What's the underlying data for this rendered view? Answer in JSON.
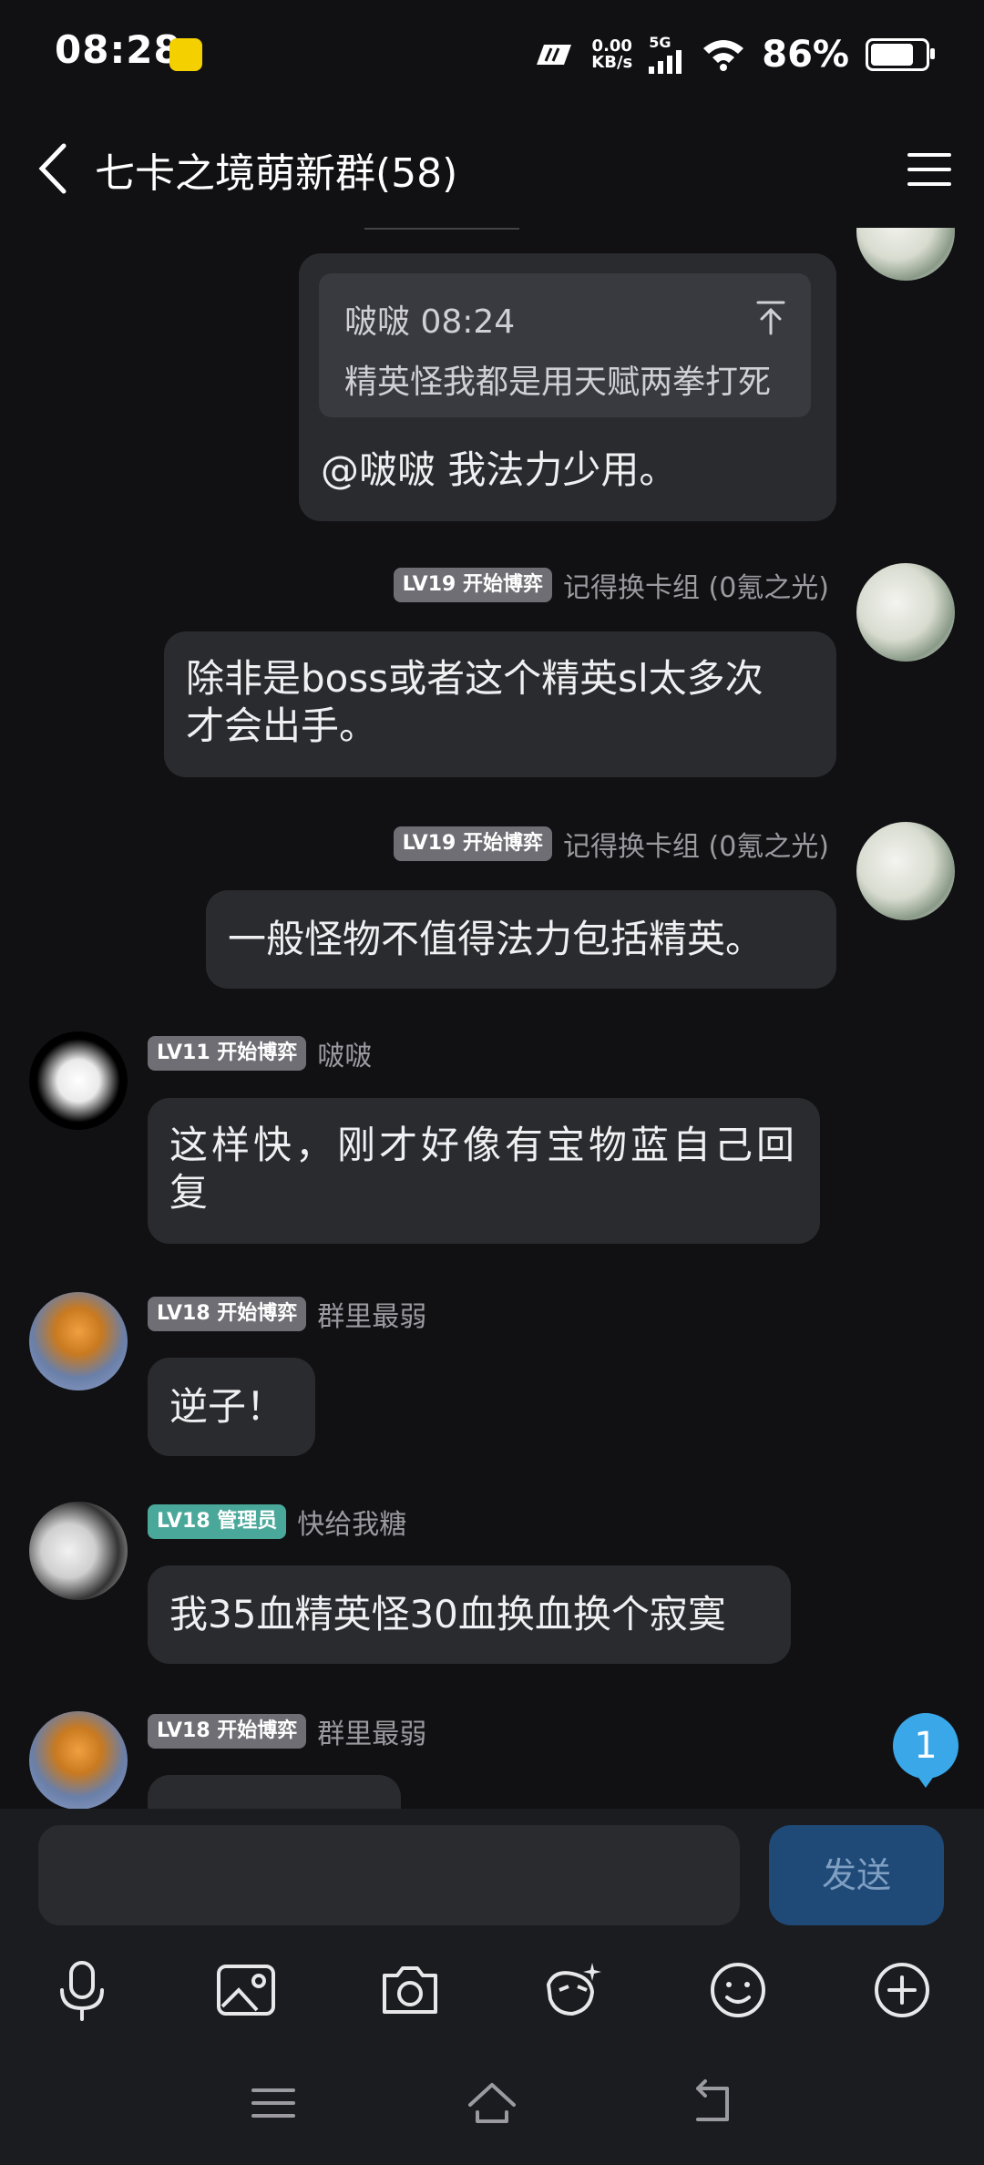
{
  "status_bar": {
    "time": "08:28",
    "speed_value": "0.00",
    "speed_unit": "KB/s",
    "network": "5G",
    "battery": "86%"
  },
  "header": {
    "title": "七卡之境萌新群(58)",
    "back_icon": "chevron-left-icon",
    "menu_icon": "hamburger-icon"
  },
  "messages": [
    {
      "id": 1,
      "side": "right",
      "quote": {
        "author_time": "啵啵 08:24",
        "text": "精英怪我都是用天赋两拳打死"
      },
      "text": "@啵啵 我法力少用。"
    },
    {
      "id": 2,
      "side": "right",
      "badge": "LV19 开始博弈",
      "name": "记得换卡组 (0氪之光)",
      "text_lines": [
        "除非是boss或者这个精英sl太多次",
        "才会出手。"
      ]
    },
    {
      "id": 3,
      "side": "right",
      "badge": "LV19 开始博弈",
      "name": "记得换卡组 (0氪之光)",
      "text": "一般怪物不值得法力包括精英。"
    },
    {
      "id": 4,
      "side": "left",
      "badge": "LV11 开始博弈",
      "name": "啵啵",
      "text_lines": [
        "这样快，刚才好像有宝物蓝自己回",
        "复"
      ]
    },
    {
      "id": 5,
      "side": "left",
      "badge": "LV18 开始博弈",
      "name": "群里最弱",
      "text": "逆子！"
    },
    {
      "id": 6,
      "side": "left",
      "badge": "LV18 管理员",
      "name": "快给我糖",
      "text": "我35血精英怪30血换血换个寂寞"
    },
    {
      "id": 7,
      "side": "left",
      "badge": "LV18 开始博弈",
      "name": "群里最弱"
    }
  ],
  "unread_count": "1",
  "input": {
    "value": "",
    "placeholder": "",
    "send_label": "发送"
  },
  "toolbar": [
    "microphone-icon",
    "image-icon",
    "camera-icon",
    "sticker-icon",
    "emoji-icon",
    "plus-icon"
  ],
  "navbar": [
    "menu-icon",
    "home-icon",
    "back-icon"
  ],
  "colors": {
    "background": "#111114",
    "bubble": "#2a2b2f",
    "admin_badge": "#4aa89a",
    "send_button": "#1f4a78",
    "unread_badge": "#3aa8e8"
  }
}
